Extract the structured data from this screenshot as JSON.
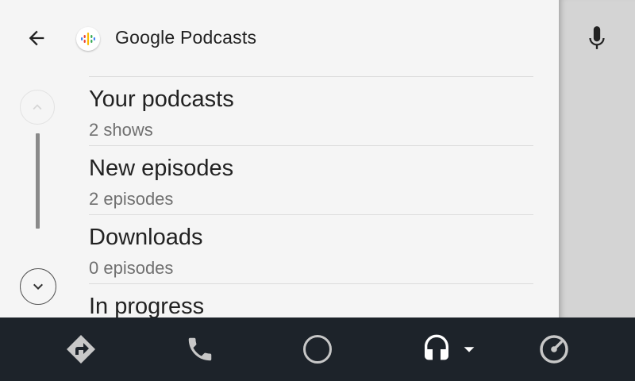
{
  "header": {
    "app_title": "Google Podcasts",
    "back_icon": "arrow-back-icon",
    "app_icon": "google-podcasts-icon"
  },
  "list": {
    "items": [
      {
        "title": "Your podcasts",
        "subtitle": "2 shows"
      },
      {
        "title": "New episodes",
        "subtitle": "2 episodes"
      },
      {
        "title": "Downloads",
        "subtitle": "0 episodes"
      },
      {
        "title": "In progress",
        "subtitle": ""
      }
    ]
  },
  "scroll": {
    "up_icon": "chevron-up-icon",
    "down_icon": "chevron-down-icon"
  },
  "side": {
    "mic_icon": "microphone-icon"
  },
  "navbar": {
    "items": [
      {
        "icon": "navigation-icon"
      },
      {
        "icon": "phone-icon"
      },
      {
        "icon": "home-circle-icon"
      },
      {
        "icon": "headphones-icon"
      },
      {
        "icon": "dashboard-icon"
      }
    ]
  },
  "colors": {
    "panel_bg": "#f5f5f5",
    "navbar_bg": "#1d232a",
    "nav_icon": "#c7c7c7",
    "text_primary": "#222222",
    "text_secondary": "#707070"
  }
}
